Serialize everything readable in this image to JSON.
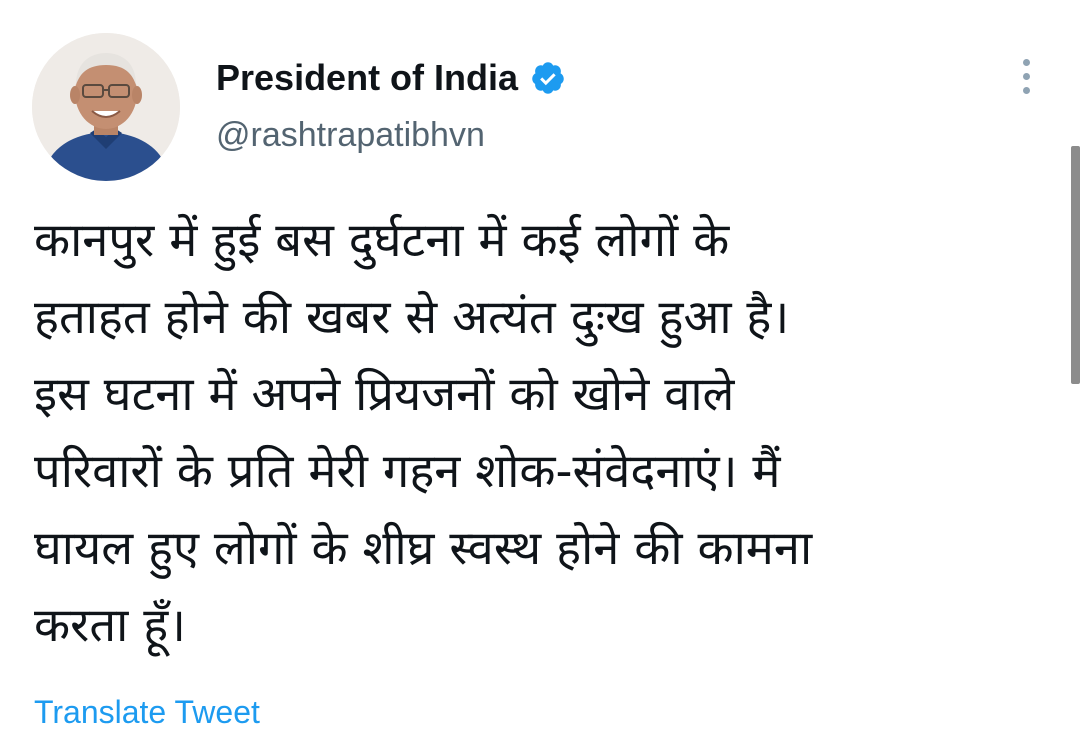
{
  "author": {
    "display_name": "President of India",
    "handle": "@rashtrapatibhvn",
    "avatar": "profile-photo",
    "verified_icon": "verified-badge-icon"
  },
  "more_icon": "more-vertical-icon",
  "tweet": {
    "lines": [
      "कानपुर में हुई बस दुर्घटना में कई लोगों के",
      "हताहत होने की खबर से अत्यंत दुःख हुआ है।",
      "इस घटना में अपने प्रियजनों को खोने वाले",
      "परिवारों के प्रति मेरी गहन शोक-संवेदनाएं। मैं",
      "घायल हुए लोगों के शीघ्र स्वस्थ होने की कामना",
      "करता हूँ।"
    ]
  },
  "translate_label": "Translate Tweet",
  "colors": {
    "accent": "#1d9bf0",
    "text": "#0f1419",
    "secondary": "#536471"
  }
}
